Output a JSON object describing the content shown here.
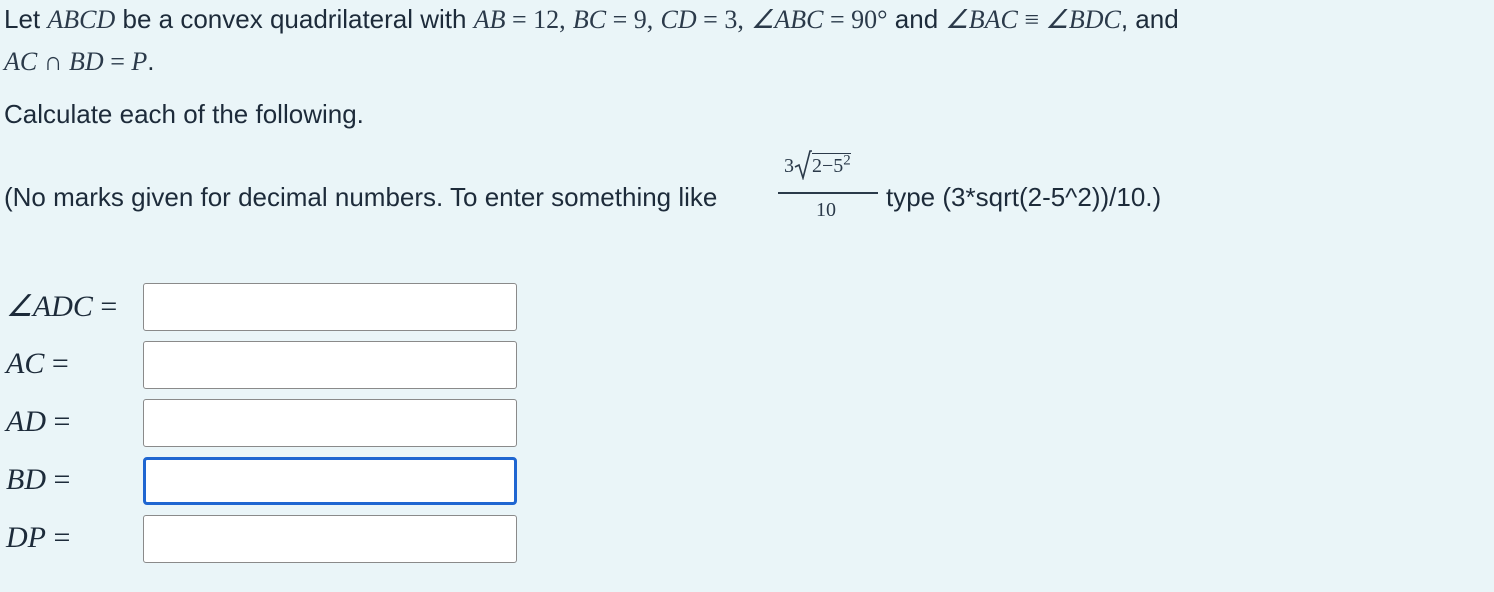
{
  "problem": {
    "let": "Let",
    "quad": "ABCD",
    "be_a_convex": "be a convex quadrilateral with",
    "ab": "AB",
    "ab_val": " = 12,",
    "bc": "BC",
    "bc_val": " = 9,",
    "cd": "CD",
    "cd_val": " = 3,",
    "angle_abc": "∠ABC",
    "angle_abc_val": " = 90°",
    "and1": "and",
    "angle_bac": "∠BAC",
    "equiv": " ≡ ",
    "angle_bdc": "∠BDC",
    "and2": ", and",
    "ac": "AC",
    "cap": " ∩ ",
    "bd": "BD",
    "eq": " = ",
    "p": "P",
    "period": "."
  },
  "instruction": "Calculate each of the following.",
  "note": {
    "before": "(No marks given for decimal numbers. To enter something like",
    "numerator": "3√2−5²",
    "num_coef": "3",
    "num_radicand": "2−5",
    "num_exp": "2",
    "denominator": "10",
    "after": "type (3*sqrt(2-5^2))/10.)"
  },
  "answers": [
    {
      "label_var": "∠ADC",
      "label_eq": " =",
      "value": "",
      "focused": false
    },
    {
      "label_var": "AC",
      "label_eq": " =",
      "value": "",
      "focused": false
    },
    {
      "label_var": "AD",
      "label_eq": " =",
      "value": "",
      "focused": false
    },
    {
      "label_var": "BD",
      "label_eq": " =",
      "value": "",
      "focused": true
    },
    {
      "label_var": "DP",
      "label_eq": " =",
      "value": "",
      "focused": false
    }
  ],
  "colors": {
    "background": "#eaf5f8",
    "focus_border": "#1f66d1",
    "box_border": "#8a8a8a"
  }
}
